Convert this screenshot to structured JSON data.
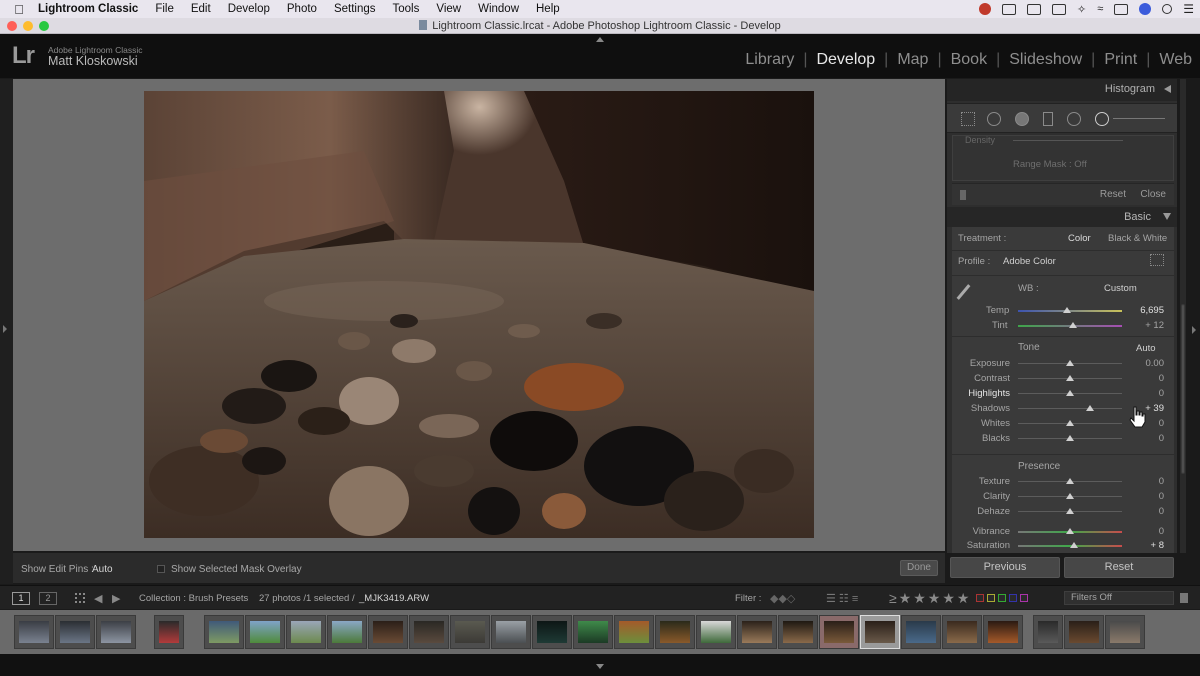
{
  "menubar": {
    "app": "Lightroom Classic",
    "items": [
      "File",
      "Edit",
      "Develop",
      "Photo",
      "Settings",
      "Tools",
      "View",
      "Window",
      "Help"
    ]
  },
  "window": {
    "title": "Lightroom Classic.lrcat - Adobe Photoshop Lightroom Classic - Develop"
  },
  "identity": {
    "logo": "Lr",
    "product": "Adobe Lightroom Classic",
    "user": "Matt Kloskowski"
  },
  "modules": [
    "Library",
    "Develop",
    "Map",
    "Book",
    "Slideshow",
    "Print",
    "Web"
  ],
  "active_module": "Develop",
  "toolbar": {
    "edit_pins_label": "Show Edit Pins :",
    "edit_pins_value": "Auto",
    "mask_overlay_label": "Show Selected Mask Overlay",
    "done_label": "Done"
  },
  "right_panel": {
    "histogram_label": "Histogram",
    "density_label": "Density",
    "range_mask": "Range Mask : Off",
    "reset_label": "Reset",
    "close_label": "Close",
    "basic_label": "Basic",
    "treatment_label": "Treatment :",
    "treatment_color": "Color",
    "treatment_bw": "Black & White",
    "profile_label": "Profile :",
    "profile_value": "Adobe Color",
    "wb_label": "WB :",
    "wb_value": "Custom",
    "temp_label": "Temp",
    "temp_value": "6,695",
    "tint_label": "Tint",
    "tint_value": "+ 12",
    "tone_label": "Tone",
    "auto_label": "Auto",
    "tone_sliders": [
      {
        "label": "Exposure",
        "value": "0.00",
        "pos": 0.5
      },
      {
        "label": "Contrast",
        "value": "0",
        "pos": 0.5
      },
      {
        "label": "Highlights",
        "value": "0",
        "pos": 0.5
      },
      {
        "label": "Shadows",
        "value": "+ 39",
        "pos": 0.69
      },
      {
        "label": "Whites",
        "value": "0",
        "pos": 0.5
      },
      {
        "label": "Blacks",
        "value": "0",
        "pos": 0.5
      }
    ],
    "presence_label": "Presence",
    "presence_sliders": [
      {
        "label": "Texture",
        "value": "0",
        "pos": 0.5
      },
      {
        "label": "Clarity",
        "value": "0",
        "pos": 0.5
      },
      {
        "label": "Dehaze",
        "value": "0",
        "pos": 0.5
      }
    ],
    "vibrance_label": "Vibrance",
    "vibrance_value": "0",
    "saturation_label": "Saturation",
    "saturation_value": "+ 8",
    "previous_label": "Previous",
    "reset_button_label": "Reset"
  },
  "filmstrip_bar": {
    "screen1": "1",
    "screen2": "2",
    "collection": "Collection : Brush Presets",
    "photo_count": "27 photos /1 selected /",
    "filename": "_MJK3419.ARW",
    "filter_label": "Filter :",
    "filters_off": "Filters Off"
  },
  "colors": {
    "accent_text": "#e8e8e8",
    "panel_bg": "#3a3a3a",
    "center_bg": "#6d6d6d"
  }
}
